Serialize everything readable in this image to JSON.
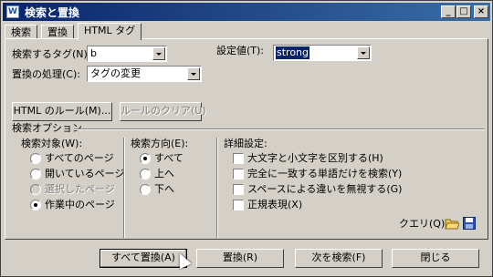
{
  "window": {
    "title": "検索と置換",
    "minimize": "_",
    "maximize": "□",
    "close": "×"
  },
  "tabs": [
    "検索",
    "置換",
    "HTML タグ"
  ],
  "form": {
    "search_tag_label": "検索するタグ(N):",
    "search_tag_value": "b",
    "replace_action_label": "置換の処理(C):",
    "replace_action_value": "タグの変更",
    "set_value_label": "設定値(T):",
    "set_value_value": "strong"
  },
  "buttons": {
    "html_rule": "HTML のルール(M)...",
    "clear_rule": "ルールのクリア(U)"
  },
  "options": {
    "section_label": "検索オプション",
    "target_label": "検索対象(W):",
    "targets": [
      "すべてのページ",
      "開いているページ",
      "選択したページ",
      "作業中のページ"
    ],
    "direction_label": "検索方向(E):",
    "directions": [
      "すべて",
      "上へ",
      "下へ"
    ],
    "detail_label": "詳細設定:",
    "details": [
      "大文字と小文字を区別する(H)",
      "完全に一致する単語だけを検索(Y)",
      "スペースによる違いを無視する(G)",
      "正規表現(X)"
    ],
    "query_label": "クエリ(Q):"
  },
  "actions": {
    "replace_all": "すべて置換(A)",
    "replace": "置換(R)",
    "find_next": "次を検索(F)",
    "close": "閉じる"
  },
  "colors": {
    "title_start": "#0a246a",
    "title_end": "#3a6ea5",
    "face": "#d4d0c8",
    "selection": "#0a246a"
  }
}
